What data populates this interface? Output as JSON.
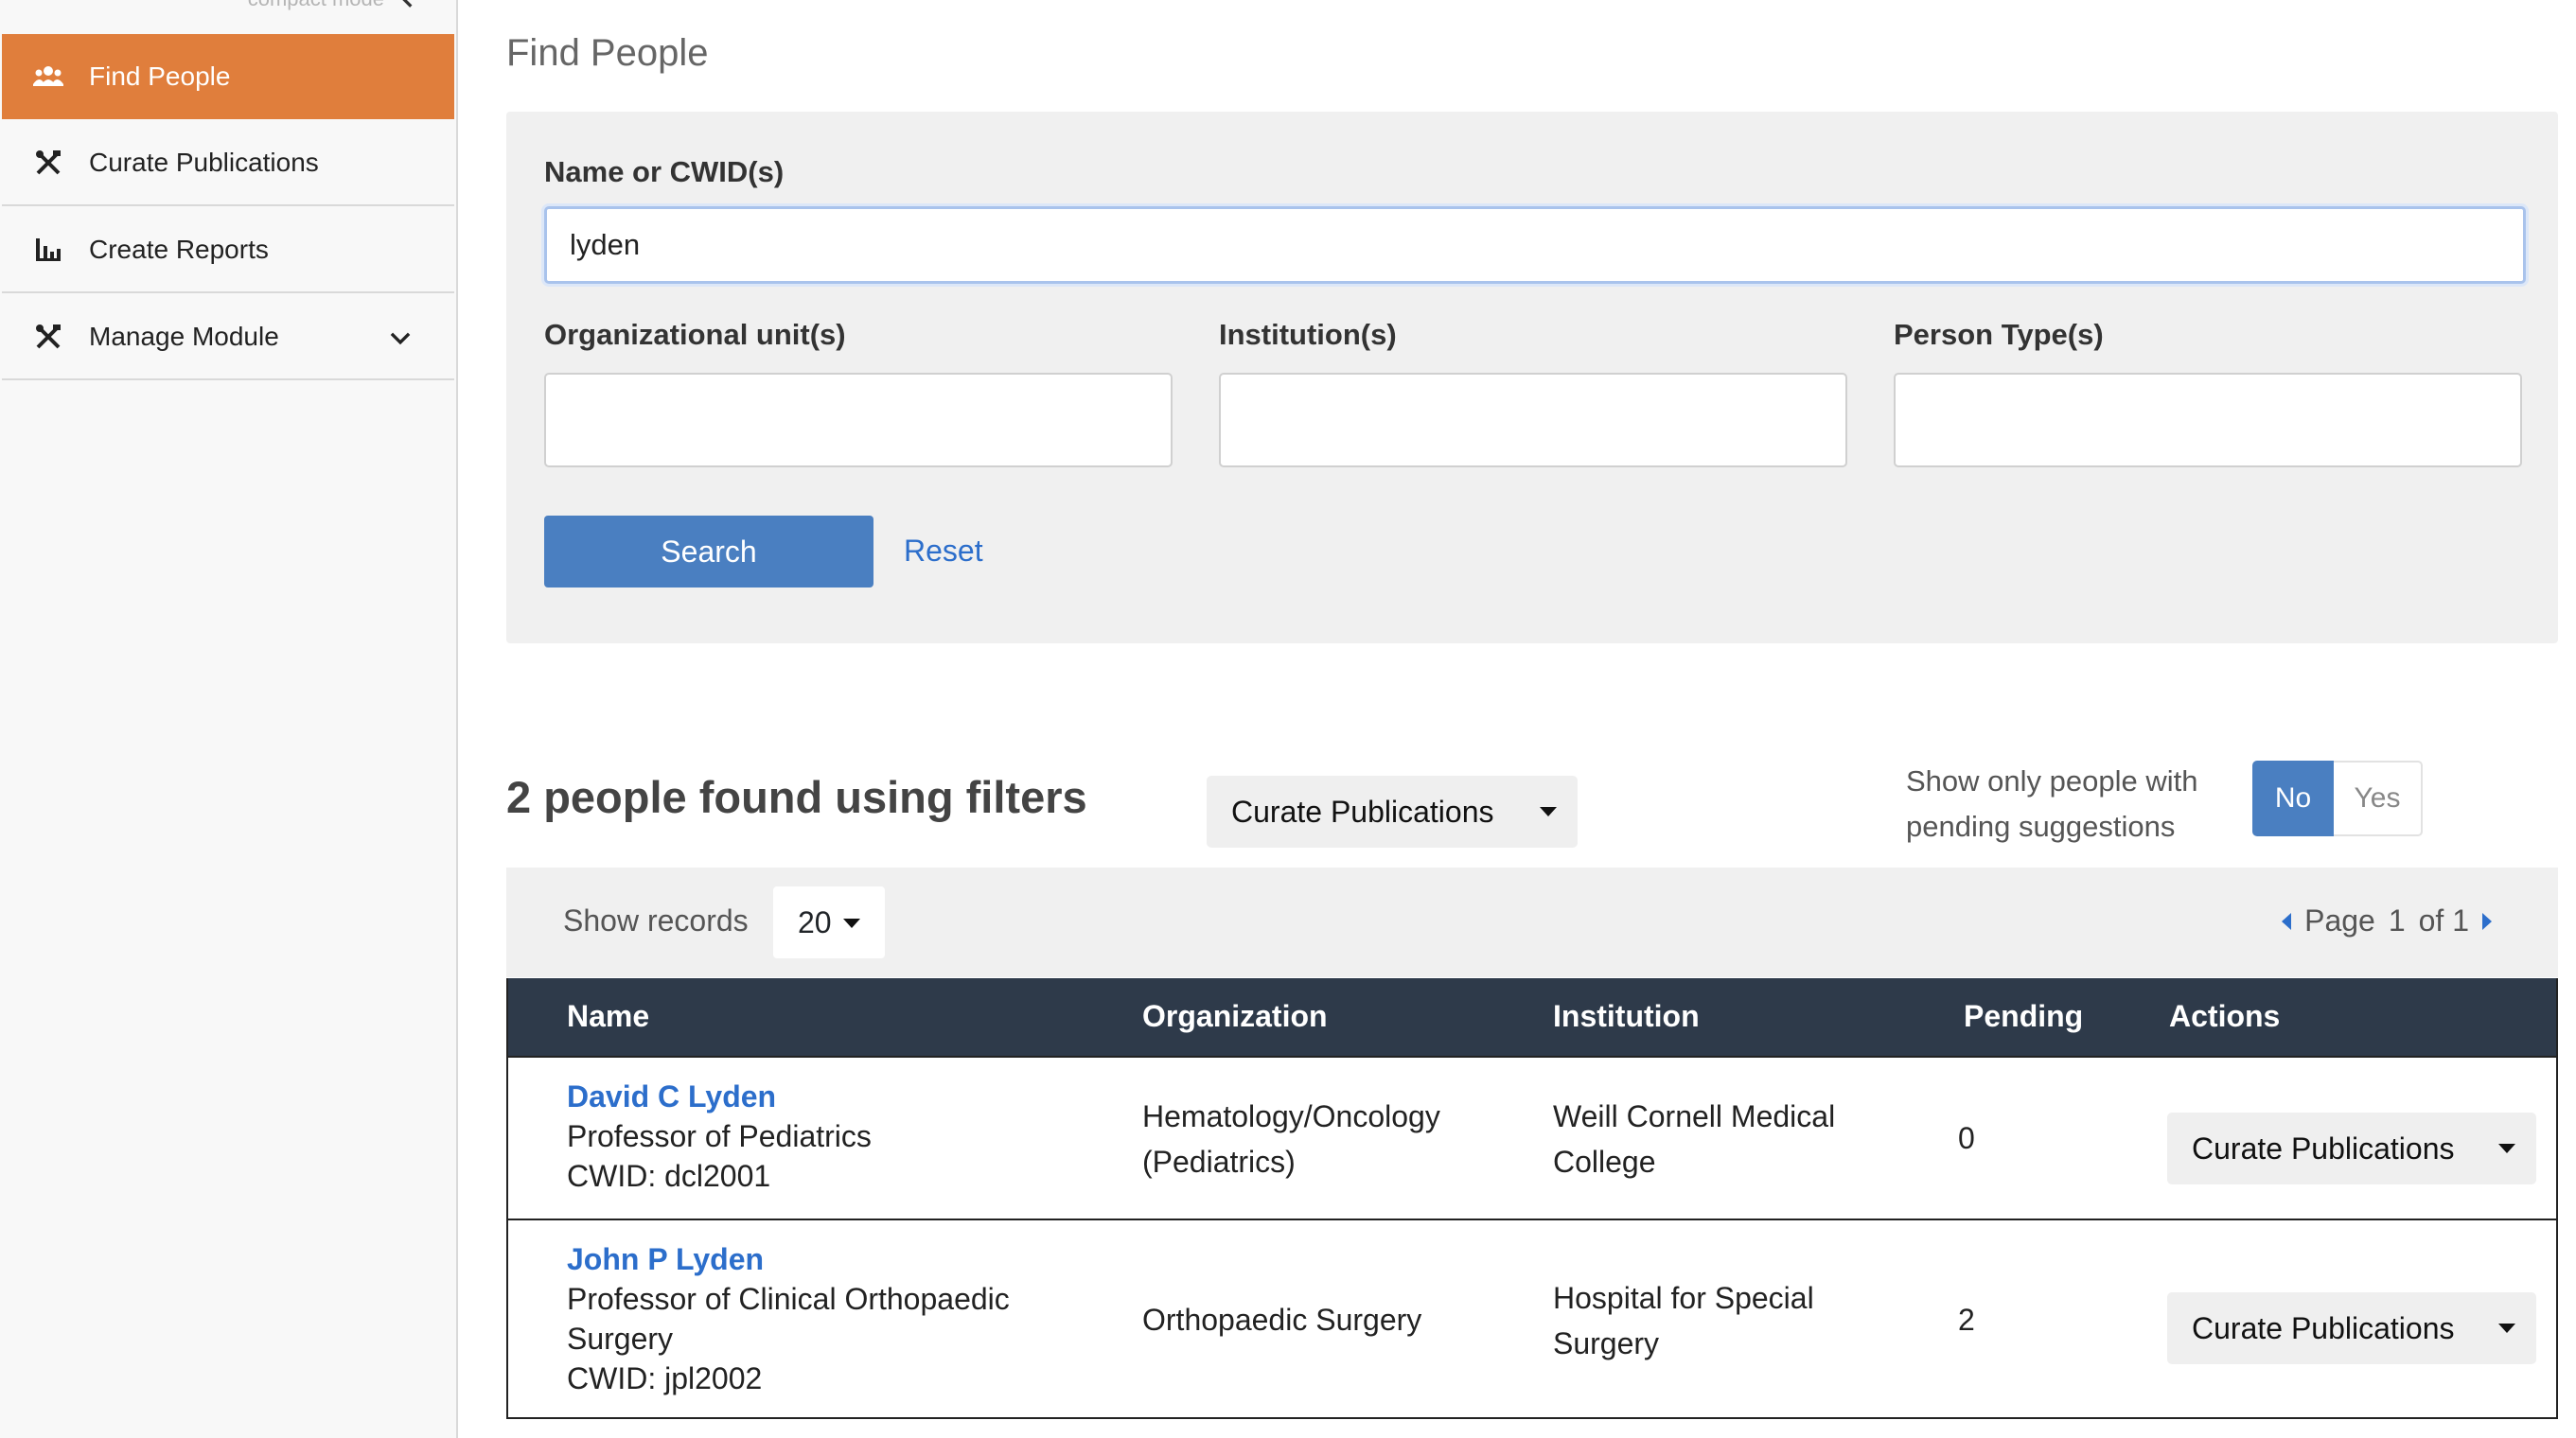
{
  "sidebar": {
    "compact_label": "compact mode",
    "items": [
      {
        "label": "Find People",
        "icon": "users-icon"
      },
      {
        "label": "Curate Publications",
        "icon": "tools-icon"
      },
      {
        "label": "Create Reports",
        "icon": "bar-chart-icon"
      },
      {
        "label": "Manage Module",
        "icon": "tools-icon"
      }
    ]
  },
  "page": {
    "title": "Find People"
  },
  "search": {
    "name_label": "Name or CWID(s)",
    "name_value": "lyden",
    "org_label": "Organizational unit(s)",
    "inst_label": "Institution(s)",
    "type_label": "Person Type(s)",
    "search_button": "Search",
    "reset_link": "Reset"
  },
  "results": {
    "summary": "2 people found using filters",
    "bulk_action": "Curate Publications",
    "pending_filter_label_1": "Show only people with",
    "pending_filter_label_2": "pending suggestions",
    "toggle_no": "No",
    "toggle_yes": "Yes",
    "toggle_selected": "No",
    "show_records_label": "Show records",
    "records_per_page": "20",
    "page_label": "Page",
    "page_current": "1",
    "page_of": "of 1"
  },
  "table": {
    "headers": {
      "name": "Name",
      "organization": "Organization",
      "institution": "Institution",
      "pending": "Pending",
      "actions": "Actions"
    },
    "rows": [
      {
        "name": "David C Lyden",
        "title": "Professor of Pediatrics",
        "cwid": "CWID: dcl2001",
        "org_1": "Hematology/Oncology",
        "org_2": "(Pediatrics)",
        "inst_1": "Weill Cornell Medical",
        "inst_2": "College",
        "pending": "0",
        "action": "Curate Publications"
      },
      {
        "name": "John P Lyden",
        "title_1": "Professor of Clinical Orthopaedic",
        "title_2": "Surgery",
        "cwid": "CWID: jpl2002",
        "org": "Orthopaedic Surgery",
        "inst_1": "Hospital for Special",
        "inst_2": "Surgery",
        "pending": "2",
        "action": "Curate Publications"
      }
    ]
  },
  "colors": {
    "accent": "#e07e3c",
    "primary": "#4a7fc1",
    "link": "#2c6ecb",
    "table_header": "#2e3a4a"
  }
}
